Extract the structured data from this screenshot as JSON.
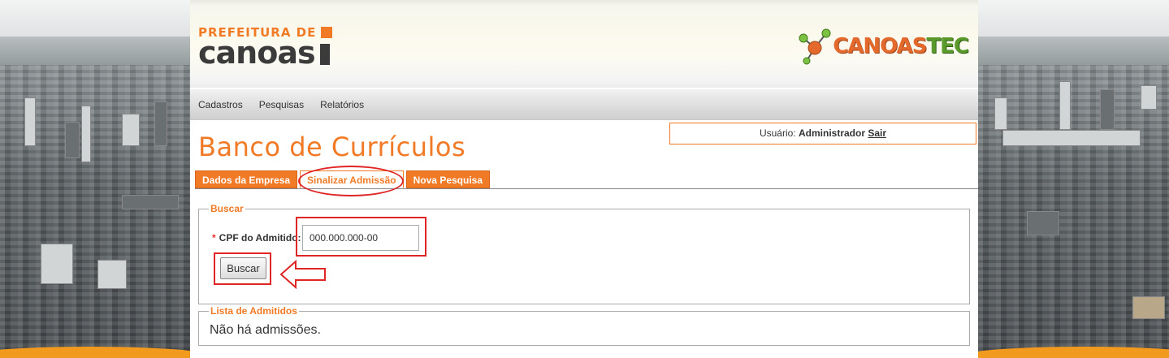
{
  "header": {
    "logo_left_top": "PREFEITURA DE",
    "logo_left_bottom": "canoas",
    "logo_right_main": "CANOAS",
    "logo_right_accent": "TEC"
  },
  "menu": {
    "items": [
      "Cadastros",
      "Pesquisas",
      "Relatórios"
    ]
  },
  "user": {
    "prefix": "Usuário:",
    "name": "Administrador",
    "logout": "Sair"
  },
  "page_title": "Banco de Currículos",
  "tabs": [
    {
      "label": "Dados da Empresa",
      "active": false
    },
    {
      "label": "Sinalizar Admissão",
      "active": true
    },
    {
      "label": "Nova Pesquisa",
      "active": false
    }
  ],
  "search": {
    "legend": "Buscar",
    "required_mark": "*",
    "cpf_label": "CPF do Admitido:",
    "cpf_value": "000.000.000-00",
    "button_label": "Buscar"
  },
  "results": {
    "legend": "Lista de Admitidos",
    "empty_message": "Não há admissões."
  },
  "colors": {
    "accent": "#f07a26",
    "highlight": "#e02525",
    "background_band": "#f29a1d"
  }
}
